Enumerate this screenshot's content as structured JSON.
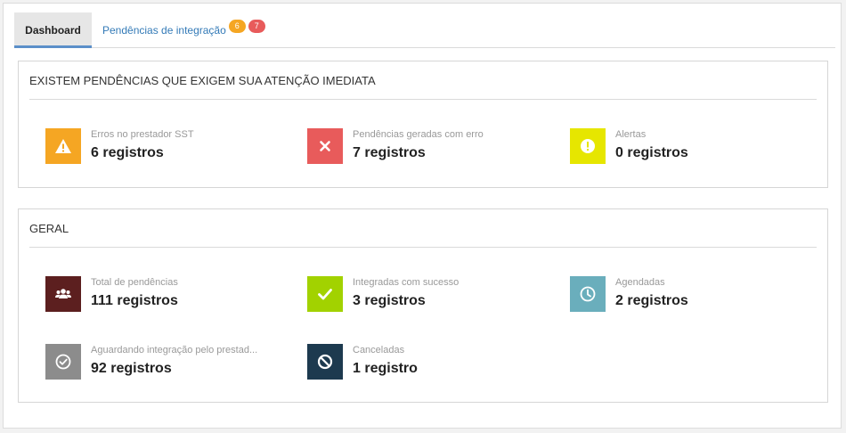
{
  "tabs": {
    "dashboard_label": "Dashboard",
    "pendencias_label": "Pendências de integração",
    "badge_warning": "6",
    "badge_error": "7"
  },
  "attention_panel": {
    "title": "EXISTEM PENDÊNCIAS QUE EXIGEM SUA ATENÇÃO IMEDIATA",
    "cards": [
      {
        "label": "Erros no prestador SST",
        "value": "6 registros",
        "icon": "warning-icon",
        "color": "#f5a623"
      },
      {
        "label": "Pendências geradas com erro",
        "value": "7 registros",
        "icon": "close-icon",
        "color": "#e85b5b"
      },
      {
        "label": "Alertas",
        "value": "0 registros",
        "icon": "exclamation-icon",
        "color": "#e6e600"
      }
    ]
  },
  "general_panel": {
    "title": "GERAL",
    "cards": [
      {
        "label": "Total de pendências",
        "value": "111 registros",
        "icon": "users-icon",
        "color": "#5c1f1f"
      },
      {
        "label": "Integradas com sucesso",
        "value": "3 registros",
        "icon": "check-icon",
        "color": "#a2d200"
      },
      {
        "label": "Agendadas",
        "value": "2 registros",
        "icon": "clock-icon",
        "color": "#6aaebc"
      },
      {
        "label": "Aguardando integração pelo prestad...",
        "value": "92 registros",
        "icon": "check-circle-icon",
        "color": "#8c8c8c"
      },
      {
        "label": "Canceladas",
        "value": "1 registro",
        "icon": "ban-icon",
        "color": "#1d3a4f"
      }
    ]
  }
}
